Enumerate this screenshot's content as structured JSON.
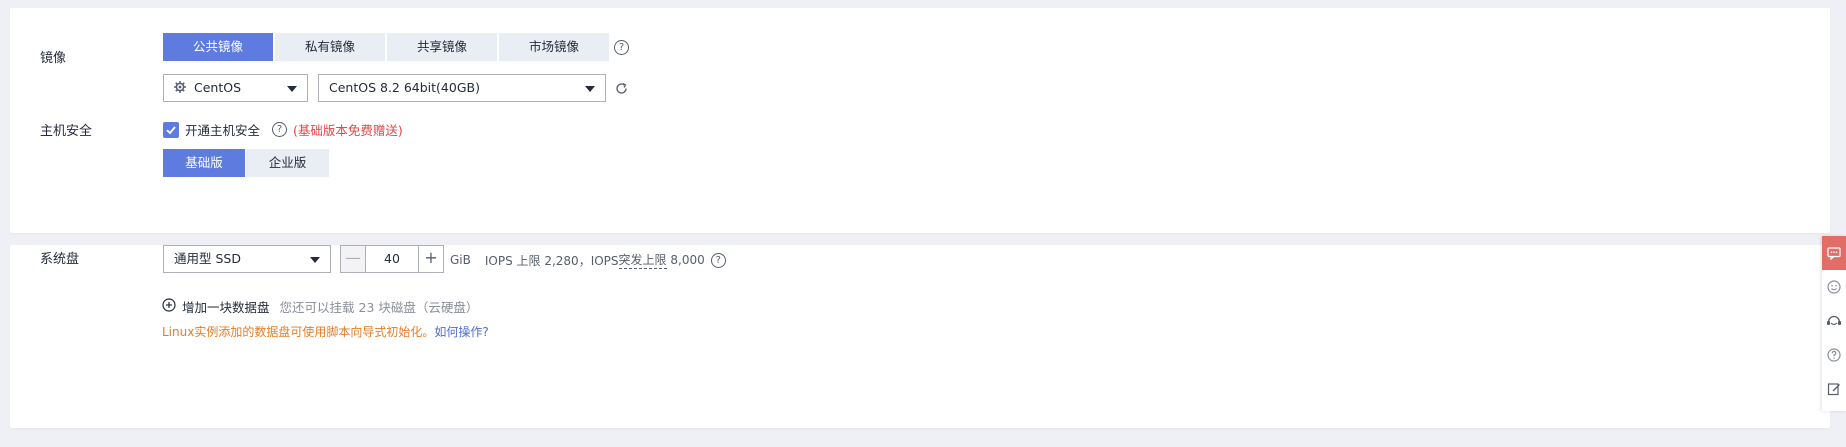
{
  "image": {
    "label": "镜像",
    "tabs": [
      {
        "label": "公共镜像",
        "active": true
      },
      {
        "label": "私有镜像",
        "active": false
      },
      {
        "label": "共享镜像",
        "active": false
      },
      {
        "label": "市场镜像",
        "active": false
      }
    ],
    "help_glyph": "?",
    "os_select": {
      "value": "CentOS",
      "icon": "gear-icon"
    },
    "version_select": {
      "value": "CentOS 8.2 64bit(40GB)"
    },
    "refresh_icon": "refresh-icon"
  },
  "host_security": {
    "label": "主机安全",
    "checkbox_label": "开通主机安全",
    "checked": true,
    "help_glyph": "?",
    "note": "(基础版本免费赠送)",
    "editions": [
      {
        "label": "基础版",
        "active": true
      },
      {
        "label": "企业版",
        "active": false
      }
    ]
  },
  "system_disk": {
    "label": "系统盘",
    "type_select": {
      "value": "通用型 SSD"
    },
    "size": {
      "value": "40",
      "decrement": "—",
      "increment": "+"
    },
    "unit": "GiB",
    "iops_prefix": "IOPS 上限 2,280，IOPS ",
    "iops_burst_label": "突发上限",
    "iops_burst_value": " 8,000",
    "help_glyph": "?",
    "add_data_disk_label": "增加一块数据盘",
    "add_data_disk_hint": "您还可以挂载 23 块磁盘（云硬盘）",
    "linux_note": "Linux实例添加的数据盘可使用脚本向导式初始化。",
    "how_to_link": "如何操作?"
  },
  "colors": {
    "primary": "#5e7ce0",
    "tab_inactive": "#e9edf4",
    "warning_red": "#e54545",
    "warning_orange": "#e37d29",
    "link_blue": "#526ecc",
    "sidebar_active": "#e16d66"
  },
  "sidebar": {
    "items": [
      {
        "name": "chat-icon",
        "active": true
      },
      {
        "name": "smiley-icon",
        "active": false
      },
      {
        "name": "headset-icon",
        "active": false
      },
      {
        "name": "question-icon",
        "active": false
      },
      {
        "name": "edit-icon",
        "active": false
      }
    ]
  }
}
